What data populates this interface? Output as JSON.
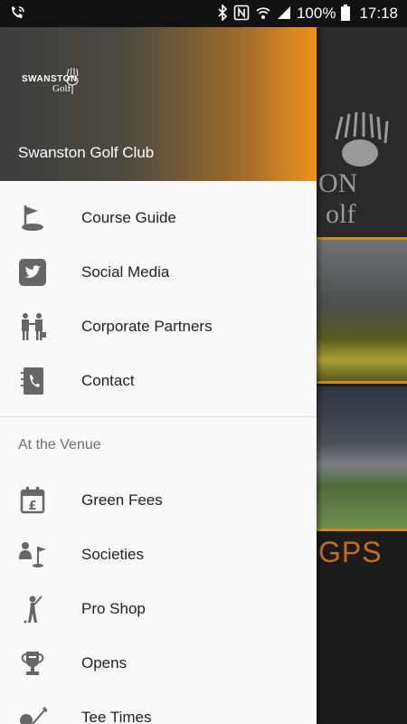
{
  "status_bar": {
    "battery": "100%",
    "time": "17:18",
    "icons": [
      "wifi-calling-icon",
      "bluetooth-icon",
      "nfc-icon",
      "wifi-icon",
      "signal-icon",
      "battery-icon"
    ]
  },
  "drawer": {
    "header": {
      "logo_line1": "SWANSTON",
      "logo_line2": "Golf",
      "title": "Swanston Golf Club"
    },
    "main_items": [
      {
        "label": "Course Guide",
        "icon": "golf-flag-icon"
      },
      {
        "label": "Social Media",
        "icon": "twitter-icon"
      },
      {
        "label": "Corporate Partners",
        "icon": "partners-handshake-icon"
      },
      {
        "label": "Contact",
        "icon": "contact-book-icon"
      }
    ],
    "section_header": "At the Venue",
    "venue_items": [
      {
        "label": "Green Fees",
        "icon": "calendar-pound-icon"
      },
      {
        "label": "Societies",
        "icon": "society-flag-icon"
      },
      {
        "label": "Pro Shop",
        "icon": "golfer-icon"
      },
      {
        "label": "Opens",
        "icon": "trophy-icon"
      },
      {
        "label": "Tee Times",
        "icon": "golf-ball-tee-icon"
      }
    ]
  },
  "background_app": {
    "logo_text_line1": "ON",
    "logo_text_line2": "olf",
    "gps_label": "GPS"
  },
  "colors": {
    "accent": "#f0901e",
    "drawer_bg": "#fafafa",
    "icon_gray": "#666666"
  }
}
